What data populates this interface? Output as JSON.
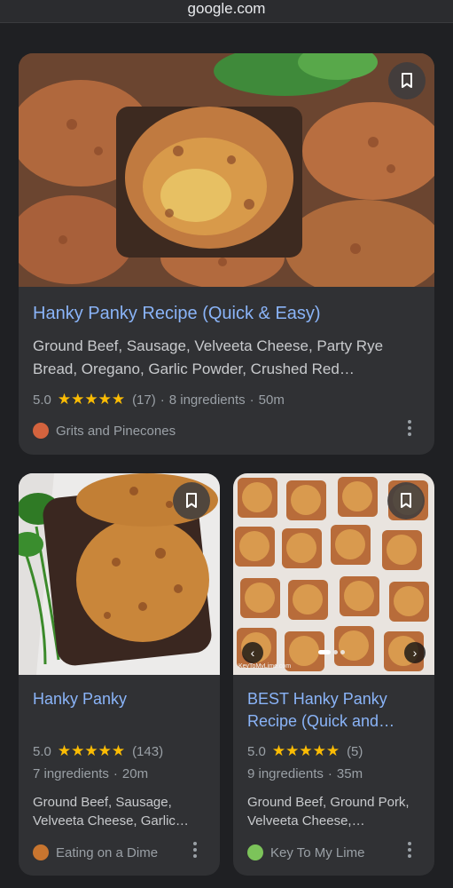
{
  "browser": {
    "url": "google.com"
  },
  "cards": [
    {
      "title": "Hanky Panky Recipe (Quick & Easy)",
      "description": "Ground Beef, Sausage, Velveeta Cheese, Party Rye Bread, Oregano, Garlic Powder, Crushed Red…",
      "rating": "5.0",
      "stars": "★★★★★",
      "reviews": "(17)",
      "ingredients": "8 ingredients",
      "time": "50m",
      "source": "Grits and Pinecones",
      "source_icon_color": "#d3633e"
    },
    {
      "title": "Hanky Panky",
      "rating": "5.0",
      "stars": "★★★★★",
      "reviews": "(143)",
      "ingredients": "7 ingredients",
      "time": "20m",
      "ingredient_list": "Ground Beef, Sausage, Velveeta Cheese, Garlic…",
      "source": "Eating on a Dime",
      "source_icon_color": "#c8752f"
    },
    {
      "title": "BEST Hanky Panky Recipe (Quick and…",
      "rating": "5.0",
      "stars": "★★★★★",
      "reviews": "(5)",
      "ingredients": "9 ingredients",
      "time": "35m",
      "ingredient_list": "Ground Beef, Ground Pork, Velveeta Cheese,…",
      "source": "Key To My Lime",
      "source_icon_color": "#7cc35a",
      "watermark": "KeyToMyLime.com"
    }
  ],
  "icons": {
    "bookmark": "bookmark-icon",
    "more": "more-vert-icon",
    "prev": "chevron-left-icon",
    "next": "chevron-right-icon"
  },
  "colors": {
    "background": "#1f2023",
    "card": "#303134",
    "link": "#8ab4f8",
    "star": "#fbbc04",
    "muted": "#9aa0a6"
  }
}
